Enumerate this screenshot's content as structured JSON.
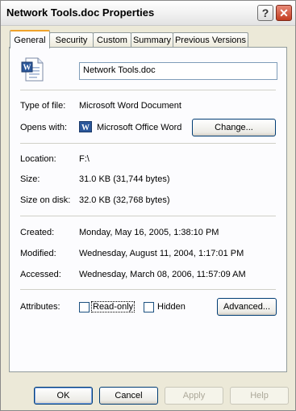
{
  "window": {
    "title": "Network Tools.doc Properties"
  },
  "titlebar_buttons": {
    "help": "?",
    "close": "✕"
  },
  "tabs": [
    {
      "label": "General",
      "active": true
    },
    {
      "label": "Security",
      "active": false
    },
    {
      "label": "Custom",
      "active": false
    },
    {
      "label": "Summary",
      "active": false
    },
    {
      "label": "Previous Versions",
      "active": false
    }
  ],
  "file": {
    "name": "Network Tools.doc"
  },
  "type": {
    "label": "Type of file:",
    "value": "Microsoft Word Document"
  },
  "opens": {
    "label": "Opens with:",
    "value": "Microsoft Office Word",
    "change_button": "Change..."
  },
  "location": {
    "label": "Location:",
    "value": "F:\\"
  },
  "size": {
    "label": "Size:",
    "value": "31.0 KB (31,744 bytes)"
  },
  "size_on_disk": {
    "label": "Size on disk:",
    "value": "32.0 KB (32,768 bytes)"
  },
  "created": {
    "label": "Created:",
    "value": "Monday, May 16, 2005, 1:38:10 PM"
  },
  "modified": {
    "label": "Modified:",
    "value": "Wednesday, August 11, 2004, 1:17:01 PM"
  },
  "accessed": {
    "label": "Accessed:",
    "value": "Wednesday, March 08, 2006, 11:57:09 AM"
  },
  "attributes": {
    "label": "Attributes:",
    "readonly": {
      "label": "Read-only",
      "checked": false
    },
    "hidden": {
      "label": "Hidden",
      "checked": false
    },
    "advanced_button": "Advanced..."
  },
  "footer": {
    "ok": "OK",
    "cancel": "Cancel",
    "apply": "Apply",
    "help": "Help"
  },
  "colors": {
    "tab_accent": "#f0a32b",
    "word_blue": "#2b579a",
    "close_red": "#c33c1f"
  },
  "icons": {
    "file": "word-document-icon",
    "app": "word-app-icon"
  }
}
